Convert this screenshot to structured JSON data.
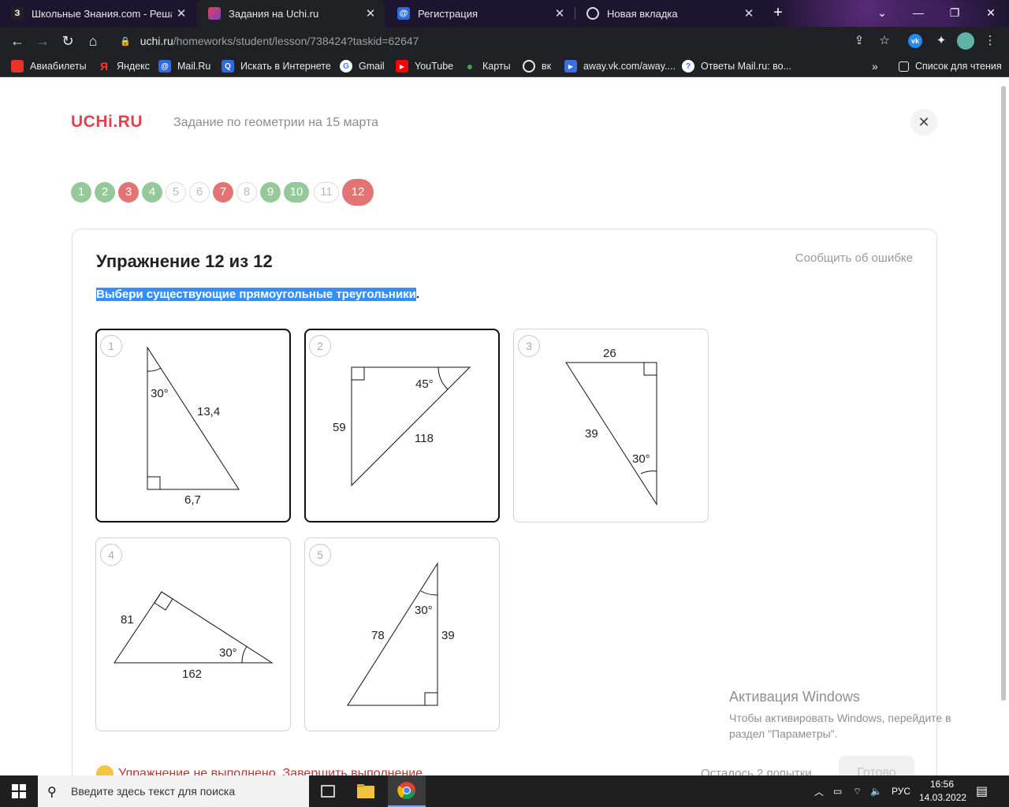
{
  "browser": {
    "tabs": [
      {
        "title": "Школьные Знания.com - Решае",
        "favicon": "З",
        "active": false
      },
      {
        "title": "Задания на Uchi.ru",
        "favicon": "",
        "active": true
      },
      {
        "title": "Регистрация",
        "favicon": "@",
        "active": false
      },
      {
        "title": "Новая вкладка",
        "favicon": "",
        "active": false
      }
    ],
    "url_host": "uchi.ru",
    "url_path": "/homeworks/student/lesson/738424?taskid=62647",
    "bookmarks": [
      {
        "label": "Авиабилеты",
        "icon": "plane-icon"
      },
      {
        "label": "Яндекс",
        "icon": "yandex-icon"
      },
      {
        "label": "Mail.Ru",
        "icon": "mailru-icon"
      },
      {
        "label": "Искать в Интернете",
        "icon": "search-icon"
      },
      {
        "label": "Gmail",
        "icon": "google-icon"
      },
      {
        "label": "YouTube",
        "icon": "youtube-icon"
      },
      {
        "label": "Карты",
        "icon": "maps-icon"
      },
      {
        "label": "вк",
        "icon": "globe-icon"
      },
      {
        "label": "away.vk.com/away....",
        "icon": "link-icon"
      },
      {
        "label": "Ответы Mail.ru: во...",
        "icon": "question-icon"
      }
    ],
    "reading_list": "Список для чтения"
  },
  "page": {
    "logo": "UCHi.RU",
    "homework_title": "Задание по геометрии на 15 марта",
    "exercise_pills": [
      {
        "n": "1",
        "state": "green"
      },
      {
        "n": "2",
        "state": "green"
      },
      {
        "n": "3",
        "state": "red"
      },
      {
        "n": "4",
        "state": "green"
      },
      {
        "n": "5",
        "state": "empty"
      },
      {
        "n": "6",
        "state": "empty"
      },
      {
        "n": "7",
        "state": "red"
      },
      {
        "n": "8",
        "state": "empty"
      },
      {
        "n": "9",
        "state": "green"
      },
      {
        "n": "10",
        "state": "green"
      },
      {
        "n": "11",
        "state": "empty"
      },
      {
        "n": "12",
        "state": "current"
      }
    ],
    "exercise_title": "Упражнение 12 из 12",
    "report_error": "Сообщить об ошибке",
    "instruction_selected": "Выбери существующие прямоугольные треугольники",
    "instruction_tail": ".",
    "tiles": [
      {
        "n": "1",
        "selected": true,
        "labels": {
          "angle": "30°",
          "hyp": "13,4",
          "leg": "6,7"
        }
      },
      {
        "n": "2",
        "selected": true,
        "labels": {
          "angle": "45°",
          "leg": "59",
          "hyp": "118"
        }
      },
      {
        "n": "3",
        "selected": false,
        "labels": {
          "leg": "26",
          "hyp": "39",
          "angle": "30°"
        }
      },
      {
        "n": "4",
        "selected": false,
        "labels": {
          "leg": "81",
          "hyp": "162",
          "angle": "30°"
        }
      },
      {
        "n": "5",
        "selected": false,
        "labels": {
          "angle": "30°",
          "hyp": "78",
          "leg": "39"
        }
      }
    ],
    "status": "Упражнение не выполнено. Завершить выполнение",
    "attempts": "Осталось 2 попытки",
    "done_button": "Готово"
  },
  "watermark": {
    "title": "Активация Windows",
    "text": "Чтобы активировать Windows, перейдите в раздел \"Параметры\"."
  },
  "taskbar": {
    "search_placeholder": "Введите здесь текст для поиска",
    "lang": "РУС",
    "time": "16:56",
    "date": "14.03.2022"
  },
  "colors": {
    "brand": "#e4404f",
    "pill_green": "#96c999",
    "pill_red": "#e27474",
    "selection": "#3390ff"
  }
}
